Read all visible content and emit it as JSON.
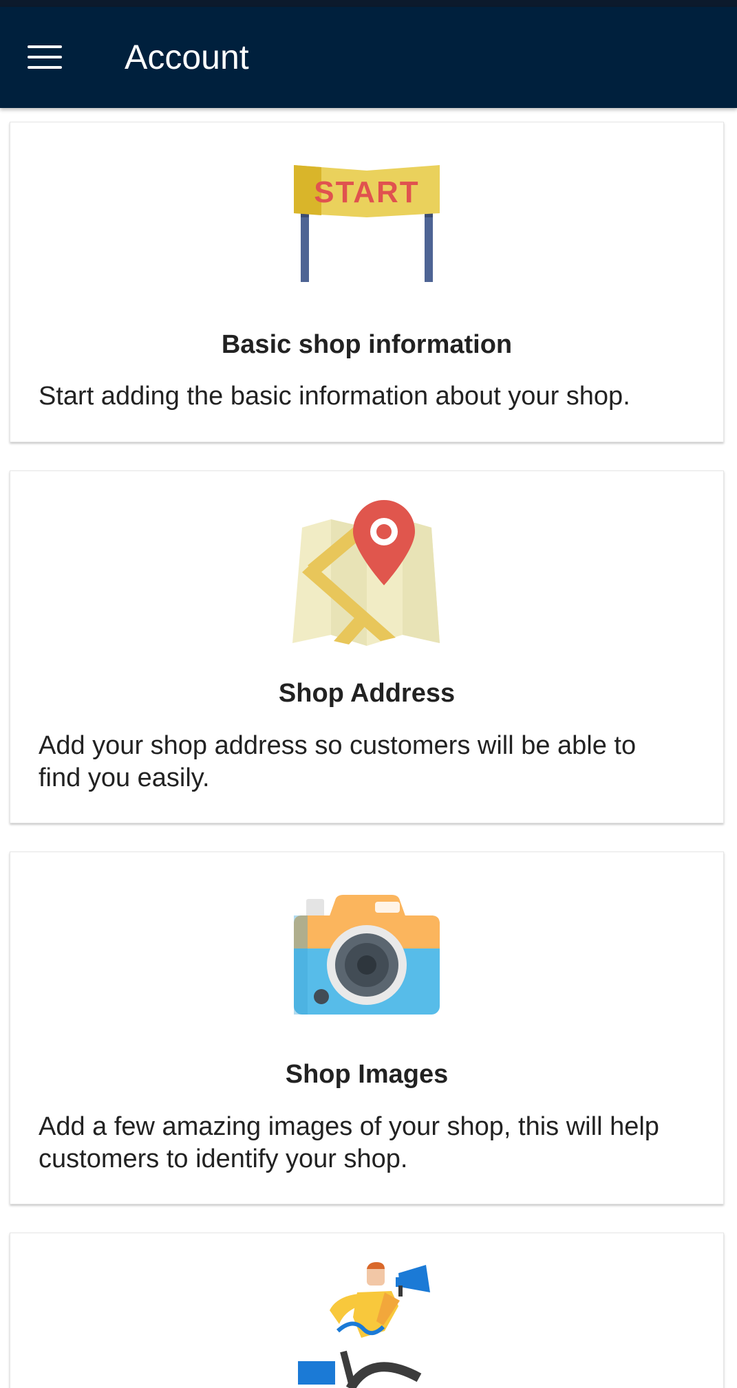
{
  "appbar": {
    "title": "Account",
    "menu_icon": "hamburger-menu-icon"
  },
  "cards": [
    {
      "icon": "start-banner-icon",
      "banner_text": "START",
      "title": "Basic shop information",
      "description": "Start adding the basic information about your shop."
    },
    {
      "icon": "map-pin-icon",
      "title": "Shop Address",
      "description": "Add your shop address so customers will be able to find you easily."
    },
    {
      "icon": "camera-icon",
      "title": "Shop Images",
      "description": "Add a few amazing images of your shop, this will help customers to identify your shop."
    },
    {
      "icon": "promoter-megaphone-icon"
    }
  ],
  "colors": {
    "appbar": "#00203d",
    "banner": "#eccf57",
    "banner_text": "#e0524f",
    "pin": "#e0564d",
    "camera_top": "#fbb55d",
    "camera_body": "#57bce9",
    "megaphone": "#1b7ad6"
  }
}
